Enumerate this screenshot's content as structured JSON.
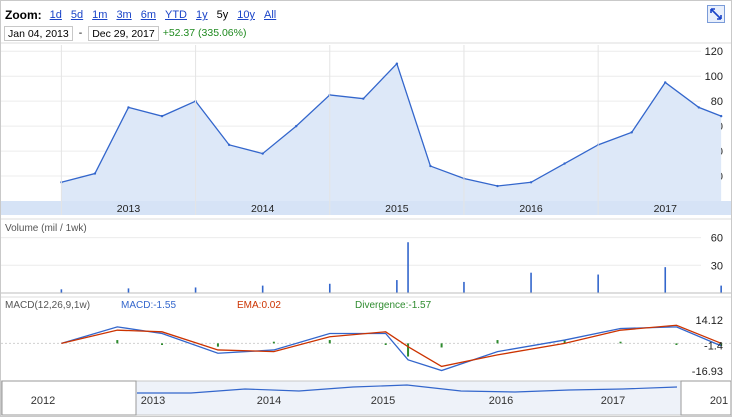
{
  "toolbar": {
    "zoom_label": "Zoom:",
    "zoom_options": [
      "1d",
      "5d",
      "1m",
      "3m",
      "6m",
      "YTD",
      "1y",
      "5y",
      "10y",
      "All"
    ],
    "active_zoom": "5y"
  },
  "range": {
    "start": "Jan 04, 2013",
    "separator": "-",
    "end": "Dec 29, 2017",
    "change": "+52.37 (335.06%)"
  },
  "colors": {
    "price_line": "#3366cc",
    "price_fill": "#dde8f8",
    "volume_bar": "#3366cc",
    "macd_line": "#3366cc",
    "ema_line": "#cc3300",
    "divergence": "#2e8b2e",
    "change_text": "#1f8a1f"
  },
  "volume_title": "Volume (mil / 1wk)",
  "macd_header": {
    "params": "MACD(12,26,9,1w)",
    "macd": "MACD:-1.55",
    "ema": "EMA:0.02",
    "divergence": "Divergence:-1.57"
  },
  "chart_data": [
    {
      "type": "area",
      "name": "price",
      "x": [
        "2013-01",
        "2013-04",
        "2013-07",
        "2013-10",
        "2014-01",
        "2014-04",
        "2014-07",
        "2014-10",
        "2015-01",
        "2015-04",
        "2015-07",
        "2015-10",
        "2016-01",
        "2016-04",
        "2016-07",
        "2016-10",
        "2017-01",
        "2017-04",
        "2017-07",
        "2017-10",
        "2017-12"
      ],
      "values": [
        15,
        22,
        75,
        68,
        80,
        45,
        38,
        60,
        85,
        82,
        110,
        28,
        18,
        12,
        15,
        30,
        45,
        55,
        95,
        75,
        68
      ],
      "y_ticks": [
        20,
        40,
        60,
        80,
        100,
        120
      ],
      "ylim": [
        0,
        125
      ],
      "x_tick_labels": [
        "2013",
        "2014",
        "2015",
        "2016",
        "2017"
      ],
      "grid": true
    },
    {
      "type": "bar",
      "name": "volume",
      "title": "Volume (mil / 1wk)",
      "y_ticks": [
        30,
        60
      ],
      "ylim": [
        0,
        65
      ],
      "x": [
        "2013-01",
        "2013-07",
        "2014-01",
        "2014-07",
        "2015-01",
        "2015-07",
        "2015-08",
        "2016-01",
        "2016-07",
        "2017-01",
        "2017-07",
        "2017-12"
      ],
      "values": [
        4,
        5,
        6,
        8,
        10,
        14,
        55,
        12,
        22,
        20,
        28,
        8
      ]
    },
    {
      "type": "line",
      "name": "MACD(12,26,9,1w)",
      "y_ticks": [
        14.12,
        -16.93
      ],
      "ylim": [
        -18,
        16
      ],
      "x": [
        "2013-01",
        "2013-06",
        "2013-10",
        "2014-03",
        "2014-08",
        "2015-01",
        "2015-06",
        "2015-08",
        "2015-11",
        "2016-04",
        "2016-10",
        "2017-03",
        "2017-08",
        "2017-12"
      ],
      "series": [
        {
          "name": "MACD",
          "values": [
            0,
            10,
            6,
            -6,
            -4,
            6,
            6,
            -10,
            -16.5,
            -5,
            2,
            9,
            10,
            -1.55
          ]
        },
        {
          "name": "EMA",
          "values": [
            0,
            8,
            7,
            -4,
            -5,
            4,
            7,
            -2,
            -14,
            -7,
            0,
            8,
            11,
            0.02
          ]
        },
        {
          "name": "Divergence",
          "values": [
            0,
            2,
            -1,
            -2,
            1,
            2,
            -1,
            -8,
            -2.5,
            2,
            2,
            1,
            -1,
            -1.57
          ]
        }
      ],
      "legend": {
        "MACD": -1.55,
        "EMA": 0.02,
        "Divergence": -1.57
      },
      "right_labels": [
        "14.12",
        "-1.4",
        "-16.93"
      ]
    },
    {
      "type": "area",
      "name": "navigator",
      "x_tick_labels": [
        "2012",
        "2013",
        "2014",
        "2015",
        "2016",
        "2017",
        "201"
      ]
    }
  ]
}
